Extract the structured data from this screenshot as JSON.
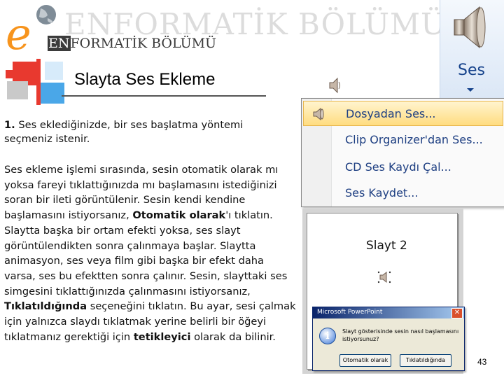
{
  "header": {
    "watermark": "ENFORMATİK BÖLÜMÜ",
    "dept_prefix": "EN",
    "dept_rest": "FORMATİK BÖLÜMÜ"
  },
  "slide_title": "Slayta Ses Ekleme",
  "body": {
    "p1_num": "1.",
    "p1_text": " Ses eklediğinizde, bir ses başlatma yöntemi seçmeniz istenir.",
    "p2_a": "Ses ekleme işlemi sırasında, sesin otomatik olarak mı yoksa fareyi tıklattığınızda mı başlamasını istediğinizi soran bir ileti görüntülenir. Sesin kendi kendine başlamasını istiyorsanız, ",
    "p2_b": "Otomatik olarak",
    "p2_c": "'ı tıklatın. Slaytta başka bir ortam efekti yoksa, ses slayt görüntülendikten sonra çalınmaya başlar. Slaytta animasyon, ses veya film gibi başka bir efekt daha varsa, ses bu efektten sonra çalınır. Sesin, slayttaki ses simgesini tıklattığınızda çalınmasını istiyorsanız, ",
    "p2_d": "Tıklatıldığında",
    "p2_e": " seçeneğini tıklatın. Bu ayar, sesi çalmak için yalnızca slaydı tıklatmak yerine belirli bir öğeyi tıklatmanız gerektiği için ",
    "p2_f": "tetikleyici",
    "p2_g": " olarak da bilinir."
  },
  "ribbon": {
    "label": "Ses"
  },
  "menu": {
    "items": [
      {
        "label": "Dosyadan Ses...",
        "icon": "speaker-icon",
        "active": true
      },
      {
        "label": "Clip Organizer'dan Ses...",
        "icon": "",
        "active": false
      },
      {
        "label": "CD Ses Kaydı Çal...",
        "icon": "",
        "active": false
      },
      {
        "label": "Ses Kaydet...",
        "icon": "",
        "active": false
      }
    ]
  },
  "preview": {
    "slide_label": "Slayt 2"
  },
  "dialog": {
    "title": "Microsoft PowerPoint",
    "message": "Slayt gösterisinde sesin nasıl başlamasını istiyorsunuz?",
    "btn_auto": "Otomatik olarak",
    "btn_click": "Tıklatıldığında",
    "close": "✕"
  },
  "page_number": "43",
  "colors": {
    "menu_text": "#1e3f82",
    "ribbon_text": "#15428b",
    "logo_orange": "#f7941d"
  }
}
